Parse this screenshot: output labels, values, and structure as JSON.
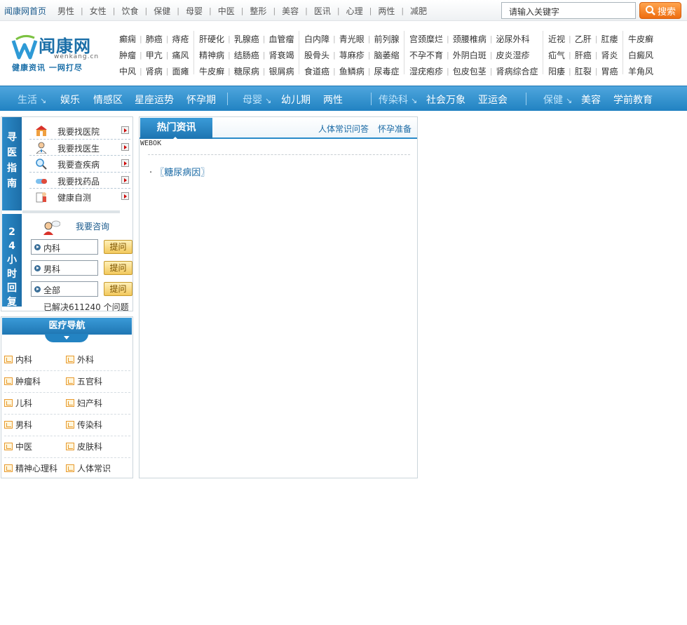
{
  "topnav": {
    "home": "闻康网首页",
    "items": [
      "男性",
      "女性",
      "饮食",
      "保健",
      "母婴",
      "中医",
      "整形",
      "美容",
      "医讯",
      "心理",
      "两性",
      "减肥"
    ]
  },
  "search": {
    "placeholder": "请输入关键字",
    "button": "搜索"
  },
  "logo": {
    "main": "闻康网",
    "url": "wenkang.cn",
    "slogan": "健康资讯 一网打尽"
  },
  "disease_groups": [
    {
      "rows": [
        [
          "癫痫",
          "肺癌",
          "痔疮"
        ],
        [
          "肿瘤",
          "甲亢",
          "痛风"
        ],
        [
          "中风",
          "肾病",
          "面瘫"
        ]
      ]
    },
    {
      "rows": [
        [
          "肝硬化",
          "乳腺癌",
          "血管瘤"
        ],
        [
          "精神病",
          "结肠癌",
          "肾衰竭"
        ],
        [
          "牛皮癣",
          "糖尿病",
          "银屑病"
        ]
      ]
    },
    {
      "rows": [
        [
          "白内障",
          "青光眼",
          "前列腺"
        ],
        [
          "股骨头",
          "荨麻疹",
          "脑萎缩"
        ],
        [
          "食道癌",
          "鱼鳞病",
          "尿毒症"
        ]
      ]
    },
    {
      "rows": [
        [
          "宫颈糜烂",
          "颈腰椎病",
          "泌尿外科"
        ],
        [
          "不孕不育",
          "外阴白斑",
          "皮炎湿疹"
        ],
        [
          "湿疣疱疹",
          "包皮包茎",
          "肾病综合症"
        ]
      ]
    },
    {
      "rows": [
        [
          "近视",
          "乙肝",
          "肛瘘"
        ],
        [
          "疝气",
          "肝癌",
          "肾炎"
        ],
        [
          "阳痿",
          "肛裂",
          "胃癌"
        ]
      ]
    },
    {
      "rows": [
        [
          "牛皮癣"
        ],
        [
          "白癜风"
        ],
        [
          "羊角风"
        ]
      ]
    }
  ],
  "bluenav": {
    "g1": {
      "cat": "生活",
      "items": [
        "娱乐",
        "情感区",
        "星座运势",
        "怀孕期"
      ]
    },
    "g2": {
      "cat": "母婴",
      "items": [
        "幼儿期",
        "两性"
      ]
    },
    "g3": {
      "cat": "传染科",
      "items": [
        "社会万象",
        "亚运会"
      ]
    },
    "g4": {
      "cat": "保健",
      "items": [
        "美容",
        "学前教育"
      ]
    }
  },
  "guide": {
    "tab1": "寻医指南",
    "items": [
      "我要找医院",
      "我要找医生",
      "我要查疾病",
      "我要找药品",
      "健康自测"
    ],
    "tab2": "24小时回复",
    "consult_label": "我要咨询",
    "questions": [
      {
        "value": "内科",
        "button": "提问"
      },
      {
        "value": "男科",
        "button": "提问"
      },
      {
        "value": "全部",
        "button": "提问"
      }
    ],
    "solved": "已解决611240 个问题"
  },
  "medical_nav": {
    "title": "医疗导航",
    "items": [
      [
        "内科",
        "外科"
      ],
      [
        "肿瘤科",
        "五官科"
      ],
      [
        "儿科",
        "妇产科"
      ],
      [
        "男科",
        "传染科"
      ],
      [
        "中医",
        "皮肤科"
      ],
      [
        "精神心理科",
        "人体常识"
      ]
    ]
  },
  "news": {
    "tab": "热门资讯",
    "links": [
      "人体常识问答",
      "怀孕准备"
    ],
    "code": "WEBOK",
    "bullet": "·",
    "items": [
      "〖糖尿病因〗"
    ]
  },
  "colors": {
    "brand": "#1b6fa8",
    "nav": "#2182c2",
    "accent": "#ee6d10"
  }
}
